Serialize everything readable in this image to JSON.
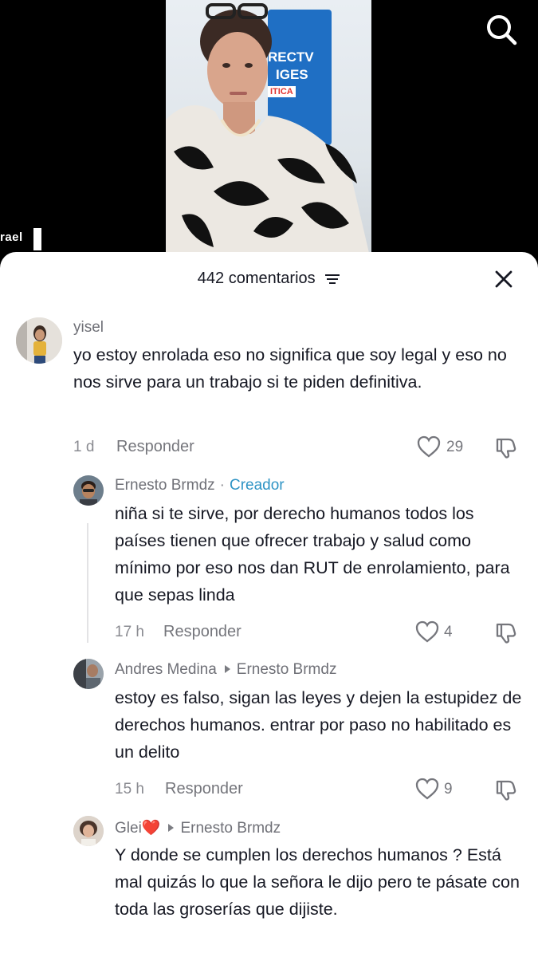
{
  "video": {
    "caption": "rael",
    "sign_line1": "RECTV",
    "sign_line2": "IGES",
    "sign_line3": "ITICA",
    "search_icon": "search-icon"
  },
  "sheet": {
    "count_label": "442 comentarios",
    "filter_icon": "filter-icon",
    "close_icon": "close-icon"
  },
  "comments": [
    {
      "user": "yisel",
      "text": "yo estoy enrolada eso no significa que soy legal y eso no nos sirve para un trabajo si te piden definitiva.",
      "time": "1 d",
      "reply": "Responder",
      "likes": "29"
    },
    {
      "user": "Ernesto Brmdz",
      "sep": "·",
      "tag": "Creador",
      "text": "niña si te sirve, por derecho humanos todos los países tienen que ofrecer trabajo y salud como mínimo por eso nos dan RUT de enrolamiento, para que sepas linda",
      "time": "17 h",
      "reply": "Responder",
      "likes": "4"
    },
    {
      "user": "Andres Medina",
      "reply_to": "Ernesto Brmdz",
      "text": "estoy es falso, sigan las leyes y dejen la estupidez de derechos humanos. entrar por paso no habilitado es un delito",
      "time": "15 h",
      "reply": "Responder",
      "likes": "9"
    },
    {
      "user": "Glei❤️",
      "reply_to": "Ernesto Brmdz",
      "text": "Y donde se cumplen los derechos humanos ? Está mal quizás lo que la señora le dijo pero te pásate con toda las groserías que dijiste."
    }
  ],
  "colors": {
    "creator": "#2f94c5",
    "text": "#161823",
    "muted": "#8a8b91"
  }
}
